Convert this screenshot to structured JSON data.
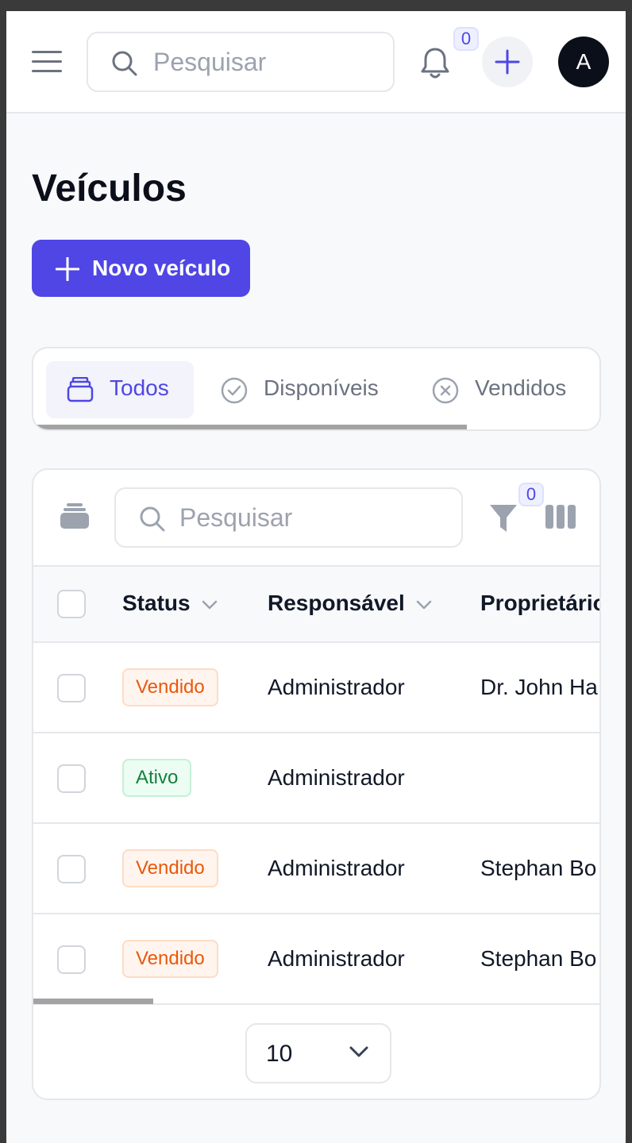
{
  "header": {
    "search_placeholder": "Pesquisar",
    "notification_count": "0",
    "avatar_initial": "A"
  },
  "page": {
    "title": "Veículos",
    "new_button_label": "Novo veículo"
  },
  "tabs": [
    {
      "label": "Todos",
      "icon": "stack-icon",
      "active": true
    },
    {
      "label": "Disponíveis",
      "icon": "check-circle-icon",
      "active": false
    },
    {
      "label": "Vendidos",
      "icon": "x-circle-icon",
      "active": false
    }
  ],
  "table": {
    "search_placeholder": "Pesquisar",
    "filter_count": "0",
    "columns": [
      "Status",
      "Responsável",
      "Proprietário"
    ],
    "rows": [
      {
        "status": "Vendido",
        "status_type": "sold",
        "responsavel": "Administrador",
        "proprietario": "Dr. John Ha"
      },
      {
        "status": "Ativo",
        "status_type": "active",
        "responsavel": "Administrador",
        "proprietario": ""
      },
      {
        "status": "Vendido",
        "status_type": "sold",
        "responsavel": "Administrador",
        "proprietario": "Stephan Bo"
      },
      {
        "status": "Vendido",
        "status_type": "sold",
        "responsavel": "Administrador",
        "proprietario": "Stephan Bo"
      }
    ],
    "page_size": "10"
  },
  "colors": {
    "accent": "#4f46e5",
    "sold_text": "#ea580c",
    "active_text": "#15803d"
  }
}
